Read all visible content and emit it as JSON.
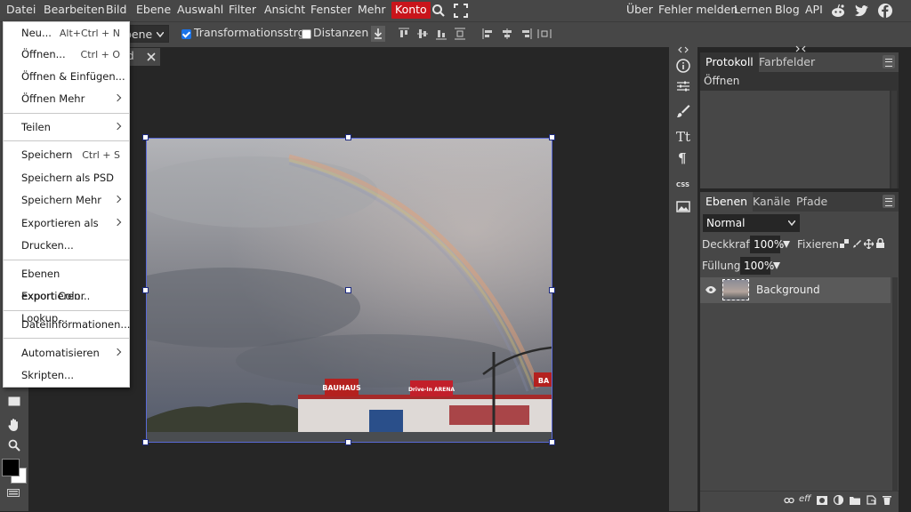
{
  "menubar": {
    "items": [
      "Datei",
      "Bearbeiten",
      "Bild",
      "Ebene",
      "Auswahl",
      "Filter",
      "Ansicht",
      "Fenster",
      "Mehr",
      "Konto"
    ],
    "links": [
      "Über",
      "Fehler melden",
      "Lernen",
      "Blog",
      "API"
    ],
    "konto_color": "#c8151b"
  },
  "options": {
    "layer_select": "bene",
    "transform_label": "Transformationsstrg.",
    "transform_checked": true,
    "distances_label": "Distanzen",
    "distances_checked": false
  },
  "doc_tab": {
    "name": "d"
  },
  "dropdown": {
    "items": [
      {
        "label": "Neu...",
        "shortcut": "Alt+Ctrl + N"
      },
      {
        "label": "Öffnen...",
        "shortcut": "Ctrl + O"
      },
      {
        "label": "Öffnen & Einfügen..."
      },
      {
        "label": "Öffnen Mehr",
        "submenu": true
      },
      {
        "label": "Teilen",
        "submenu": true
      },
      {
        "label": "Speichern",
        "shortcut": "Ctrl + S"
      },
      {
        "label": "Speichern als PSD"
      },
      {
        "label": "Speichern Mehr",
        "submenu": true
      },
      {
        "label": "Exportieren als",
        "submenu": true
      },
      {
        "label": "Drucken..."
      },
      {
        "label": "Ebenen exportieren..."
      },
      {
        "label": "Export Color Lookup..."
      },
      {
        "label": "Dateiinformationen..."
      },
      {
        "label": "Automatisieren",
        "submenu": true
      },
      {
        "label": "Skripten..."
      }
    ]
  },
  "history_panel": {
    "tabs": [
      "Protokoll",
      "Farbfelder"
    ],
    "entries": [
      "Öffnen"
    ]
  },
  "layers_panel": {
    "tabs": [
      "Ebenen",
      "Kanäle",
      "Pfade"
    ],
    "blend_mode": "Normal",
    "opacity_label": "Deckkraft:",
    "opacity_value": "100%",
    "lock_label": "Fixieren:",
    "fill_label": "Füllung:",
    "fill_value": "100%",
    "layers": [
      {
        "name": "Background",
        "visible": true
      }
    ],
    "footer_fx": "eff"
  },
  "midstrip": {
    "css_label": "CSS"
  },
  "canvas": {
    "signs": [
      "BAUHAUS",
      "Drive-In ARENA",
      "BA"
    ]
  },
  "colors": {
    "accent": "#1a73e8",
    "selection": "#5a6ad8"
  }
}
